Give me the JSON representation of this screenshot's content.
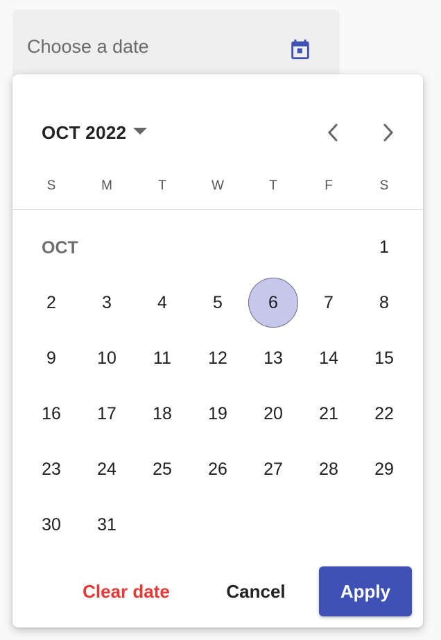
{
  "field": {
    "label": "Choose a date",
    "icon": "calendar-icon"
  },
  "picker": {
    "month_label": "OCT 2022",
    "month_row_label": "OCT",
    "weekdays": [
      "S",
      "M",
      "T",
      "W",
      "T",
      "F",
      "S"
    ],
    "selected_day": "6",
    "days": [
      "1",
      "2",
      "3",
      "4",
      "5",
      "6",
      "7",
      "8",
      "9",
      "10",
      "11",
      "12",
      "13",
      "14",
      "15",
      "16",
      "17",
      "18",
      "19",
      "20",
      "21",
      "22",
      "23",
      "24",
      "25",
      "26",
      "27",
      "28",
      "29",
      "30",
      "31"
    ],
    "buttons": {
      "clear": "Clear date",
      "cancel": "Cancel",
      "apply": "Apply"
    }
  },
  "colors": {
    "accent": "#3f51b5",
    "selected_fill": "#c5c8ea",
    "clear_text": "#e53935",
    "field_bg": "#efefef"
  }
}
